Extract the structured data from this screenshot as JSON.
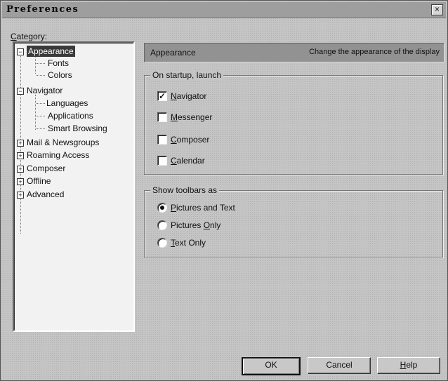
{
  "window": {
    "title": "Preferences",
    "close_glyph": "×"
  },
  "category_label_underlined": "C",
  "category_label_rest": "ategory:",
  "tree": [
    {
      "label": "Appearance",
      "expander": "−",
      "selected": true
    },
    {
      "label": "Fonts"
    },
    {
      "label": "Colors"
    },
    {
      "label": "Navigator",
      "expander": "−"
    },
    {
      "label": "Languages"
    },
    {
      "label": "Applications"
    },
    {
      "label": "Smart Browsing"
    },
    {
      "label": "Mail & Newsgroups",
      "expander": "+"
    },
    {
      "label": "Roaming Access",
      "expander": "+"
    },
    {
      "label": "Composer",
      "expander": "+"
    },
    {
      "label": "Offline",
      "expander": "+"
    },
    {
      "label": "Advanced",
      "expander": "+"
    }
  ],
  "panel": {
    "title": "Appearance",
    "description": "Change the appearance of the display"
  },
  "startup": {
    "legend": "On startup, launch",
    "items": [
      {
        "u": "N",
        "rest": "avigator",
        "checked": true,
        "mark": "✓"
      },
      {
        "u": "M",
        "rest": "essenger",
        "checked": false,
        "mark": ""
      },
      {
        "u": "C",
        "rest": "omposer",
        "checked": false,
        "mark": ""
      },
      {
        "u": "C",
        "rest": "alendar",
        "checked": false,
        "mark": ""
      }
    ]
  },
  "toolbars": {
    "legend": "Show toolbars as",
    "options": [
      {
        "u": "P",
        "rest": "ictures and Text",
        "selected": true
      },
      {
        "pre": "Pictures ",
        "u": "O",
        "rest": "nly",
        "selected": false
      },
      {
        "u": "T",
        "rest": "ext Only",
        "selected": false
      }
    ]
  },
  "buttons": {
    "ok": "OK",
    "cancel": "Cancel",
    "help_u": "H",
    "help_rest": "elp"
  }
}
